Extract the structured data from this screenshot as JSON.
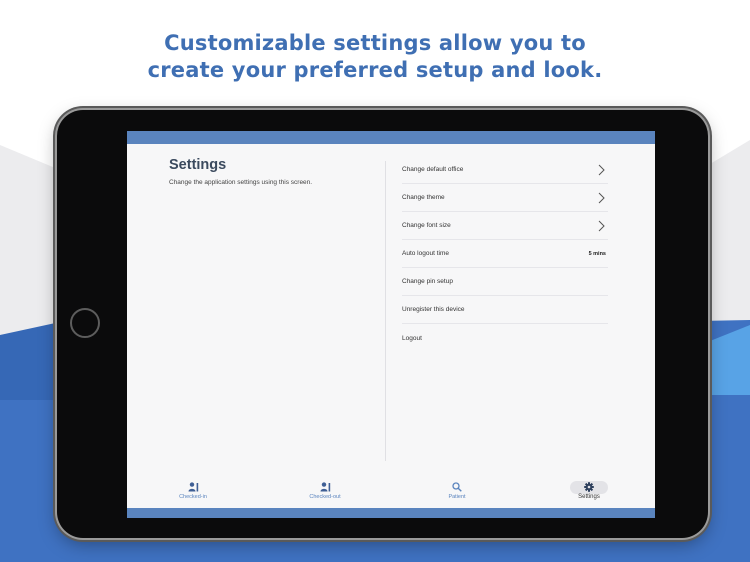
{
  "headline": {
    "line1": "Customizable settings allow you to",
    "line2": "create your preferred setup and look."
  },
  "settings": {
    "title": "Settings",
    "subtitle": "Change the application settings using this screen.",
    "items": [
      {
        "label": "Change default office",
        "chevron": true
      },
      {
        "label": "Change theme",
        "chevron": true
      },
      {
        "label": "Change font size",
        "chevron": true
      },
      {
        "label": "Auto logout time",
        "value": "5 mins"
      },
      {
        "label": "Change pin setup"
      },
      {
        "label": "Unregister this device"
      },
      {
        "label": "Logout"
      }
    ]
  },
  "tabs": [
    {
      "label": "Checked-in",
      "icon": "checked-in-icon"
    },
    {
      "label": "Checked-out",
      "icon": "checked-out-icon"
    },
    {
      "label": "Patient",
      "icon": "search-icon"
    },
    {
      "label": "Settings",
      "icon": "gear-icon",
      "active": true
    }
  ],
  "colors": {
    "accent": "#5a84be",
    "headline": "#3f6fb3",
    "background_band": "#3f72c2"
  }
}
